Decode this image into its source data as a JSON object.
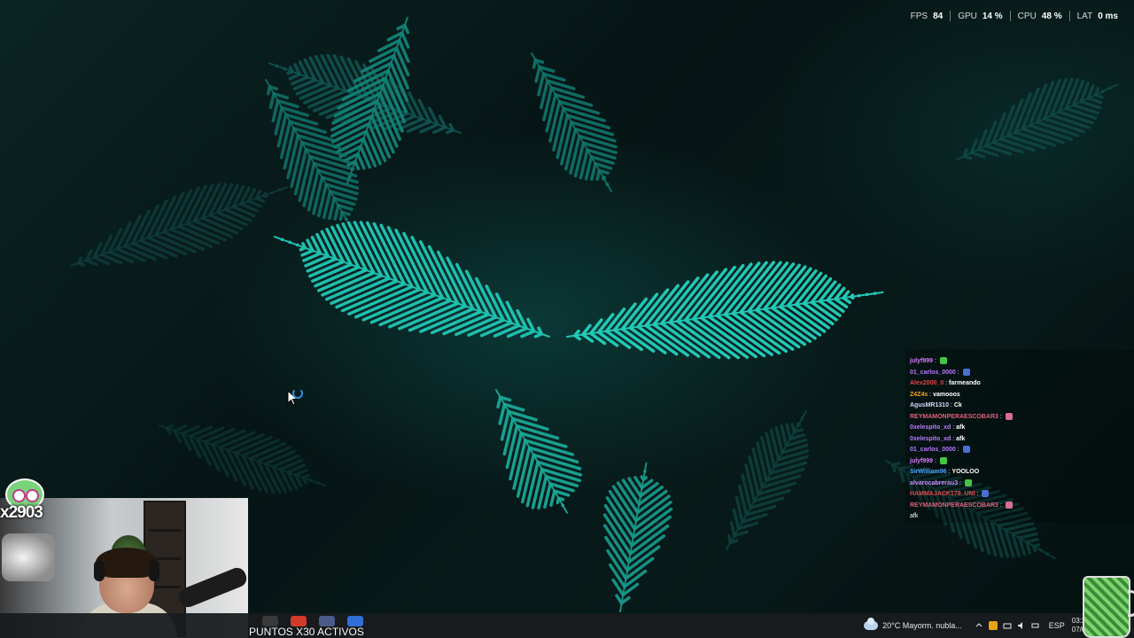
{
  "overlay_stats": {
    "fps_label": "FPS",
    "fps_value": "84",
    "gpu_label": "GPU",
    "gpu_value": "14 %",
    "cpu_label": "CPU",
    "cpu_value": "48 %",
    "lat_label": "LAT",
    "lat_value": "0 ms"
  },
  "chat": {
    "messages": [
      {
        "user": "julyf999",
        "text": "",
        "emote": "green",
        "color": "#d57bff"
      },
      {
        "user": "01_carlos_0000",
        "text": "",
        "emote": "blue",
        "color": "#b878ff"
      },
      {
        "user": "Alex2000_0",
        "text": "farmeando",
        "emote": "",
        "color": "#e64545"
      },
      {
        "user": "Z4Z4s",
        "text": "vamooos",
        "emote": "",
        "color": "#f5a623"
      },
      {
        "user": "AgusMR1310",
        "text": "Ck",
        "emote": "",
        "color": "#d8d8ff"
      },
      {
        "user": "REYMAMONPERAESCOBAR3",
        "text": "",
        "emote": "pink",
        "color": "#e0607e"
      },
      {
        "user": "0xelespito_xd",
        "text": "afk",
        "emote": "",
        "color": "#b87cff"
      },
      {
        "user": "0xelespito_xd",
        "text": "afk",
        "emote": "",
        "color": "#b87cff"
      },
      {
        "user": "01_carlos_0000",
        "text": "",
        "emote": "blue",
        "color": "#b878ff"
      },
      {
        "user": "julyf999",
        "text": "",
        "emote": "green",
        "color": "#d57bff"
      },
      {
        "user": "SirWilliam96",
        "text": "YOOLOO",
        "emote": "",
        "color": "#4aa3ff"
      },
      {
        "user": "alvarocabrerau3",
        "text": "",
        "emote": "green",
        "color": "#c88bff"
      },
      {
        "user": "HAMMAJACK179_UNI",
        "text": "",
        "emote": "blue",
        "color": "#e04a4a"
      },
      {
        "user": "REYMAMONPERAESCOBAR3",
        "text": "",
        "emote": "pink",
        "color": "#e0607e"
      }
    ],
    "trailing_text": "afk"
  },
  "badge": {
    "label": "x2903"
  },
  "taskbar": {
    "points_label": "PUNTOS X30 ACTIVOS",
    "weather": "20°C  Mayorm. nubla...",
    "language": "ESP",
    "time": "03:24",
    "date": "07/01/"
  },
  "colors": {
    "accent_teal": "#1fbfae",
    "emote_green": "#47c447",
    "emote_blue": "#4a6fd1",
    "emote_pink": "#d66f8f"
  },
  "icons": [
    "fern-wallpaper",
    "mouse-cursor-icon",
    "loading-ring-icon",
    "cloud-icon",
    "chevron-up-icon",
    "wifi-icon",
    "speaker-icon",
    "battery-icon"
  ]
}
